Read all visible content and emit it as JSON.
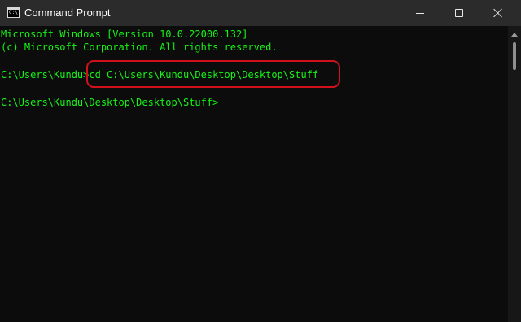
{
  "window": {
    "title": "Command Prompt",
    "app_icon": "command-prompt-icon",
    "app_icon_text": "C:\\.",
    "controls": [
      "minimize-icon",
      "maximize-icon",
      "close-icon"
    ]
  },
  "console": {
    "lines": [
      "Microsoft Windows [Version 10.0.22000.132]",
      "(c) Microsoft Corporation. All rights reserved.",
      "C:\\Users\\Kundu>cd C:\\Users\\Kundu\\Desktop\\Desktop\\Stuff",
      "C:\\Users\\Kundu\\Desktop\\Desktop\\Stuff>"
    ],
    "text_color": "#16f316",
    "background_color": "#0c0c0c",
    "highlight_color": "#d0111c"
  },
  "scrollbar": {
    "up_icon": "scroll-up-arrow-icon"
  }
}
